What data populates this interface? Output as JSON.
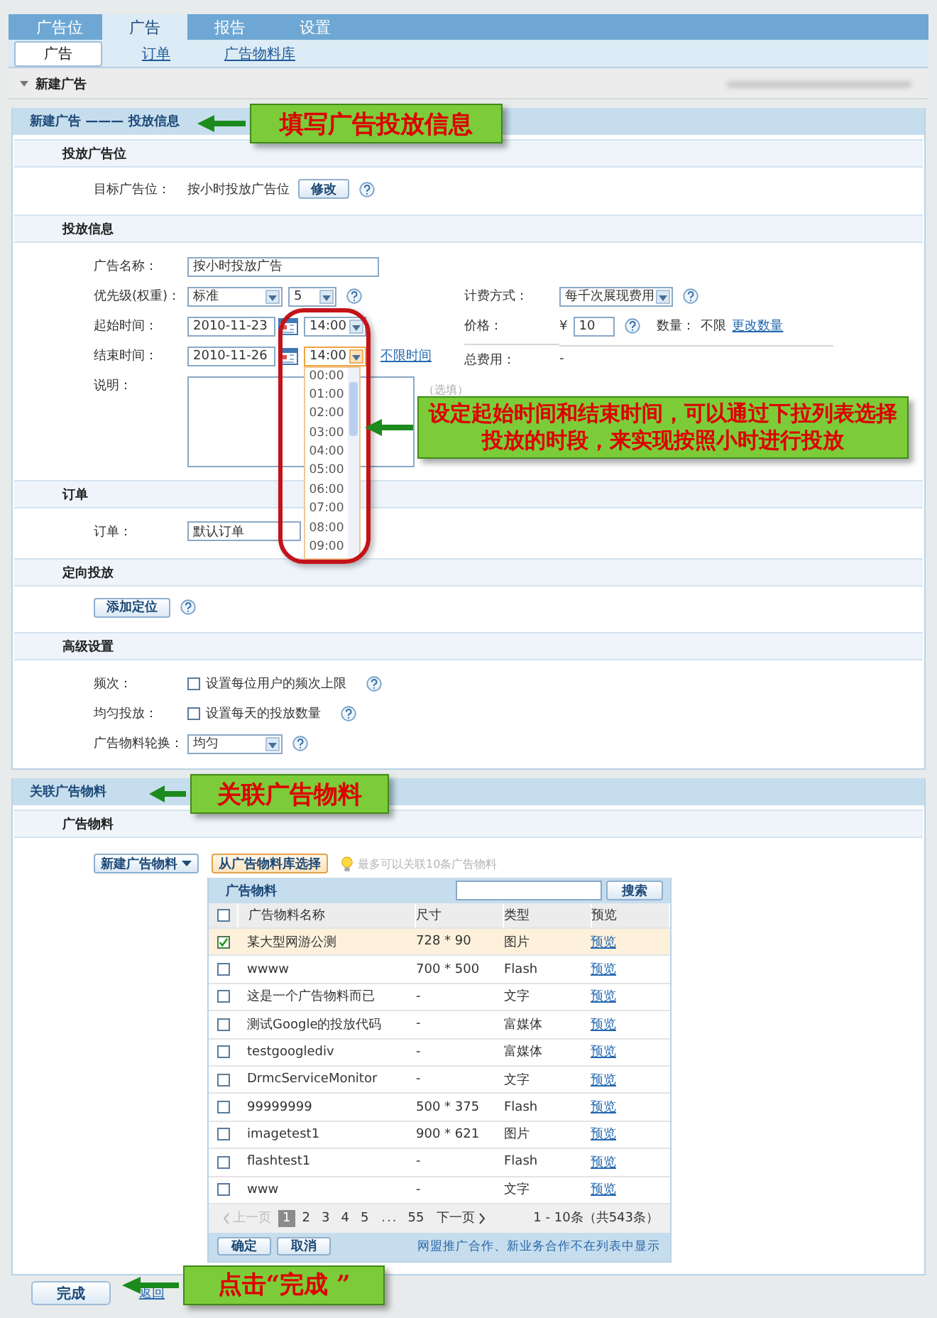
{
  "main_tabs": [
    {
      "label": "广告位",
      "selected": false
    },
    {
      "label": "广告",
      "selected": true
    },
    {
      "label": "报告",
      "selected": false
    },
    {
      "label": "设置",
      "selected": false
    }
  ],
  "sub_tabs": [
    {
      "label": "广告",
      "selected": true
    },
    {
      "label": "订单",
      "selected": false
    },
    {
      "label": "广告物料库",
      "selected": false
    }
  ],
  "page_title": "新建广告",
  "placement": {
    "title": "新建广告 ——— 投放信息",
    "callout": "填写广告投放信息",
    "ad_slot": {
      "heading": "投放广告位",
      "label": "目标广告位：",
      "value": "按小时投放广告位",
      "button": "修改"
    },
    "delivery": {
      "heading": "投放信息",
      "name": {
        "label": "广告名称：",
        "value": "按小时投放广告"
      },
      "priority": {
        "label": "优先级(权重)：",
        "value": "标准",
        "weight": "5"
      },
      "billing": {
        "label": "计费方式：",
        "value": "每千次展现费用"
      },
      "start": {
        "label": "起始时间：",
        "date": "2010-11-23",
        "time": "14:00"
      },
      "price": {
        "label": "价格：",
        "currency": "¥",
        "value": "10"
      },
      "quantity": {
        "label": "数量：",
        "value": "不限",
        "link": "更改数量"
      },
      "end": {
        "label": "结束时间：",
        "date": "2010-11-26",
        "time": "14:00",
        "link": "不限时间"
      },
      "total": {
        "label": "总费用：",
        "value": "-"
      },
      "note": {
        "label": "说明：",
        "hint": "（选填）"
      },
      "time_dropdown": {
        "options": [
          "00:00",
          "01:00",
          "02:00",
          "03:00",
          "04:00",
          "05:00",
          "06:00",
          "07:00",
          "08:00",
          "09:00"
        ],
        "callout": "设定起始时间和结束时间，可以通过下拉列表选择投放的时段，来实现按照小时进行投放"
      }
    },
    "order": {
      "heading": "订单",
      "label": "订单：",
      "value": "默认订单"
    },
    "targeting": {
      "heading": "定向投放",
      "button": "添加定位"
    },
    "advanced": {
      "heading": "高级设置",
      "options": [
        {
          "label": "频次：",
          "text": "设置每位用户的频次上限",
          "checked": false
        },
        {
          "label": "均匀投放：",
          "text": "设置每天的投放数量",
          "checked": false
        }
      ],
      "rotation": {
        "label": "广告物料轮换：",
        "value": "均匀"
      }
    }
  },
  "materials": {
    "title": "关联广告物料",
    "callout": "关联广告物料",
    "heading": "广告物料",
    "new_button": "新建广告物料",
    "library_button": "从广告物料库选择",
    "tip": "最多可以关联10条广告物料",
    "table": {
      "title": "广告物料",
      "search_button": "搜索",
      "columns": [
        "广告物料名称",
        "尺寸",
        "类型",
        "预览"
      ],
      "header_checked": false,
      "rows": [
        {
          "name": "某大型网游公测",
          "size": "728 * 90",
          "type": "图片",
          "preview": "预览",
          "checked": true
        },
        {
          "name": "wwww",
          "size": "700 * 500",
          "type": "Flash",
          "preview": "预览",
          "checked": false
        },
        {
          "name": "这是一个广告物料而已",
          "size": "-",
          "type": "文字",
          "preview": "预览",
          "checked": false
        },
        {
          "name": "测试Google的投放代码",
          "size": "-",
          "type": "富媒体",
          "preview": "预览",
          "checked": false
        },
        {
          "name": "testgooglediv",
          "size": "-",
          "type": "富媒体",
          "preview": "预览",
          "checked": false
        },
        {
          "name": "DrmcServiceMonitor",
          "size": "-",
          "type": "文字",
          "preview": "预览",
          "checked": false
        },
        {
          "name": "99999999",
          "size": "500 * 375",
          "type": "Flash",
          "preview": "预览",
          "checked": false
        },
        {
          "name": "imagetest1",
          "size": "900 * 621",
          "type": "图片",
          "preview": "预览",
          "checked": false
        },
        {
          "name": "flashtest1",
          "size": "-",
          "type": "Flash",
          "preview": "预览",
          "checked": false
        },
        {
          "name": "www",
          "size": "-",
          "type": "文字",
          "preview": "预览",
          "checked": false
        }
      ],
      "pager": {
        "prev": "上一页",
        "pages": [
          {
            "kind": "page",
            "label": "1",
            "selected": true
          },
          {
            "kind": "page",
            "label": "2",
            "selected": false
          },
          {
            "kind": "page",
            "label": "3",
            "selected": false
          },
          {
            "kind": "page",
            "label": "4",
            "selected": false
          },
          {
            "kind": "page",
            "label": "5",
            "selected": false
          },
          {
            "kind": "gap",
            "label": "..."
          },
          {
            "kind": "page",
            "label": "55",
            "selected": false
          }
        ],
        "next": "下一页",
        "summary": "1 - 10条（共543条）"
      },
      "confirm": "确定",
      "cancel": "取消",
      "note": "网盟推广合作、新业务合作不在列表中显示"
    }
  },
  "footer": {
    "done": "完成",
    "back": "返回",
    "callout": "点击“完成 ”"
  }
}
